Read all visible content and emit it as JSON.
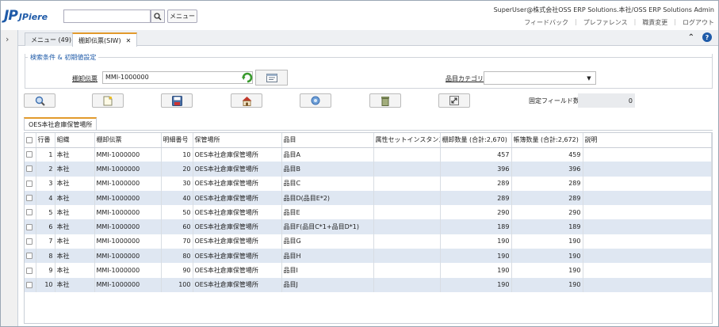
{
  "header": {
    "logo_jp": "JP",
    "logo_piere": "JPiere",
    "menu_button": "メニュー",
    "user_info": "SuperUser@株式会社OSS ERP Solutions.本社/OSS ERP Solutions Admin",
    "links": [
      "フィードバック",
      "プレファレンス",
      "職責変更",
      "ログアウト"
    ]
  },
  "tabs": {
    "menu_tab": "メニュー (49)",
    "active_tab": "棚卸伝票(SIW)",
    "close_glyph": "✕"
  },
  "search": {
    "legend": "検索条件 & 初期値設定",
    "doc_label": "棚卸伝票",
    "doc_value": "MMI-1000000",
    "category_label": "品目カテゴリ",
    "category_value": ""
  },
  "toolbar": {
    "fixed_label": "固定フィールド数",
    "fixed_value": "0",
    "buttons": [
      "search-icon",
      "new-record-icon",
      "save-icon",
      "home-icon",
      "settings-icon",
      "delete-icon",
      "expand-icon"
    ]
  },
  "grid": {
    "tab_label": "OES本社倉庫保管場所",
    "columns": [
      "行番",
      "組織",
      "棚卸伝票",
      "明細番号",
      "保管場所",
      "品目",
      "属性セットインスタンス",
      "棚卸数量 (合計:2,670)",
      "帳簿数量 (合計:2,672)",
      "説明"
    ],
    "rows": [
      {
        "line": "1",
        "org": "本社",
        "doc": "MMI-1000000",
        "lineno": "10",
        "locator": "OES本社倉庫保管場所",
        "product": "品目A",
        "asi": "",
        "count": "457",
        "book": "459",
        "desc": ""
      },
      {
        "line": "2",
        "org": "本社",
        "doc": "MMI-1000000",
        "lineno": "20",
        "locator": "OES本社倉庫保管場所",
        "product": "品目B",
        "asi": "",
        "count": "396",
        "book": "396",
        "desc": ""
      },
      {
        "line": "3",
        "org": "本社",
        "doc": "MMI-1000000",
        "lineno": "30",
        "locator": "OES本社倉庫保管場所",
        "product": "品目C",
        "asi": "",
        "count": "289",
        "book": "289",
        "desc": ""
      },
      {
        "line": "4",
        "org": "本社",
        "doc": "MMI-1000000",
        "lineno": "40",
        "locator": "OES本社倉庫保管場所",
        "product": "品目D(品目E*2)",
        "asi": "",
        "count": "289",
        "book": "289",
        "desc": ""
      },
      {
        "line": "5",
        "org": "本社",
        "doc": "MMI-1000000",
        "lineno": "50",
        "locator": "OES本社倉庫保管場所",
        "product": "品目E",
        "asi": "",
        "count": "290",
        "book": "290",
        "desc": ""
      },
      {
        "line": "6",
        "org": "本社",
        "doc": "MMI-1000000",
        "lineno": "60",
        "locator": "OES本社倉庫保管場所",
        "product": "品目F(品目C*1+品目D*1)",
        "asi": "",
        "count": "189",
        "book": "189",
        "desc": ""
      },
      {
        "line": "7",
        "org": "本社",
        "doc": "MMI-1000000",
        "lineno": "70",
        "locator": "OES本社倉庫保管場所",
        "product": "品目G",
        "asi": "",
        "count": "190",
        "book": "190",
        "desc": ""
      },
      {
        "line": "8",
        "org": "本社",
        "doc": "MMI-1000000",
        "lineno": "80",
        "locator": "OES本社倉庫保管場所",
        "product": "品目H",
        "asi": "",
        "count": "190",
        "book": "190",
        "desc": ""
      },
      {
        "line": "9",
        "org": "本社",
        "doc": "MMI-1000000",
        "lineno": "90",
        "locator": "OES本社倉庫保管場所",
        "product": "品目I",
        "asi": "",
        "count": "190",
        "book": "190",
        "desc": ""
      },
      {
        "line": "10",
        "org": "本社",
        "doc": "MMI-1000000",
        "lineno": "100",
        "locator": "OES本社倉庫保管場所",
        "product": "品目J",
        "asi": "",
        "count": "190",
        "book": "190",
        "desc": ""
      }
    ]
  },
  "colors": {
    "brand": "#1e5aa8",
    "tab_accent": "#e29a2c",
    "row_alt": "#dfe7f2"
  }
}
